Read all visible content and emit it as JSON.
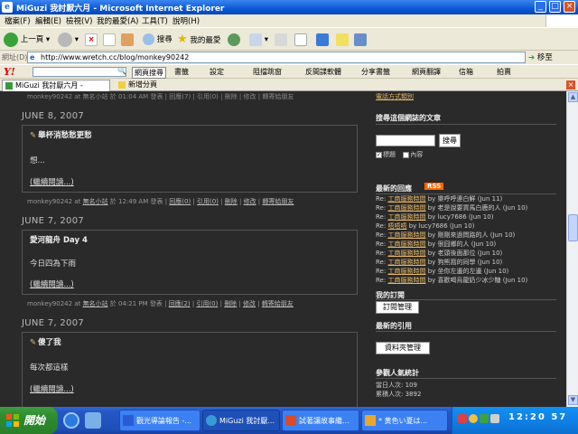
{
  "window": {
    "title": "MiGuzi 我討厭六月 - Microsoft Internet Explorer"
  },
  "menu": [
    "檔案(F)",
    "編輯(E)",
    "檢視(V)",
    "我的最愛(A)",
    "工具(T)",
    "說明(H)"
  ],
  "toolbar": {
    "back": "上一頁",
    "search": "搜尋",
    "favorites": "我的最愛"
  },
  "address": {
    "label": "網址(D)",
    "url": "http://www.wretch.cc/blog/monkey90242",
    "go": "移至"
  },
  "yahoo": {
    "search_button": "網頁搜尋",
    "items": [
      "書籤",
      "設定",
      "阻擋跳窗",
      "反間諜軟體",
      "分享書籤",
      "網頁翻譯",
      "信箱",
      "拍賣"
    ]
  },
  "tabs": {
    "active": "MiGuzi 我討厭六月 -",
    "new": "新增分頁"
  },
  "top_meta": "monkey90242 at 無名小站 於 01:04 AM 發表 | 回應(7) | 引用(0) | 刪除 | 修改 | 轉寄給朋友",
  "posts": [
    {
      "date": "JUNE 8, 2007",
      "title": "舉杯消愁愁更愁",
      "body": "想...",
      "more": "(繼續閱讀...)",
      "meta_author": "monkey90242 at",
      "meta_site": "無名小站",
      "meta_time": "於 12:49 AM 發表",
      "meta_links": [
        "回應(0)",
        "引用(0)",
        "刪除",
        "修改",
        "轉寄給朋友"
      ]
    },
    {
      "date": "JUNE 7, 2007",
      "title": "愛河龍舟 Day 4",
      "body": "今日四為下雨",
      "more": "(繼續閱讀...)",
      "meta_author": "monkey90242 at",
      "meta_site": "無名小站",
      "meta_time": "於 04:21 PM 發表",
      "meta_links": [
        "回應(2)",
        "引用(0)",
        "刪除",
        "修改",
        "轉寄給朋友"
      ]
    },
    {
      "date": "JUNE 7, 2007",
      "title": "傻了我",
      "body": "每次都這樣",
      "more": "(繼續閱讀...)"
    }
  ],
  "sidebar": {
    "top_link": "電話方式類別",
    "search_heading": "搜尋這個網誌的文章",
    "search_button": "搜尋",
    "checkbox_title": "標題",
    "checkbox_content": "內容",
    "comments_heading": "最新的回應",
    "rss_badge": "RSS",
    "comments": [
      {
        "re": "Re:",
        "post": "工商服務時間",
        "by": "by 樂呼呼連白鮮 (Jun 11)"
      },
      {
        "re": "Re:",
        "post": "工商服務時間",
        "by": "by 老是說要買馬白鹿的人 (Jun 10)"
      },
      {
        "re": "Re:",
        "post": "工商服務時間",
        "by": "by lucy7686 (Jun 10)"
      },
      {
        "re": "Re:",
        "post": "唔唔唔",
        "by": "by lucy7686 (Jun 10)"
      },
      {
        "re": "Re:",
        "post": "工商服務時間",
        "by": "by 剛剛來過問路的人 (Jun 10)"
      },
      {
        "re": "Re:",
        "post": "工商服務時間",
        "by": "by 很囧鄉的人 (Jun 10)"
      },
      {
        "re": "Re:",
        "post": "工商服務時間",
        "by": "by 老頭後面那位 (Jun 10)"
      },
      {
        "re": "Re:",
        "post": "工商服務時間",
        "by": "by 狗熊窩的同學 (Jun 10)"
      },
      {
        "re": "Re:",
        "post": "工商服務時間",
        "by": "by 坐你左邊的左邊 (Jun 10)"
      },
      {
        "re": "Re:",
        "post": "工商服務時間",
        "by": "by 喜歡喝烏龍奶少冰少糖 (Jun 10)"
      }
    ],
    "subscribe_heading": "我的訂閱",
    "subscribe_button": "訂閱管理",
    "trackback_heading": "最新的引用",
    "folder_button": "資料夾管理",
    "stats_heading": "參觀人氣統計",
    "today": "當日人次: 109",
    "total": "累積人次: 3892"
  },
  "taskbar": {
    "start": "開始",
    "tasks": [
      "觀光導論報告 -...",
      "MiGuzi 我討厭...",
      "試著讓故事繼...",
      "* 黄色い夏は..."
    ],
    "clock": "12:20 57"
  }
}
